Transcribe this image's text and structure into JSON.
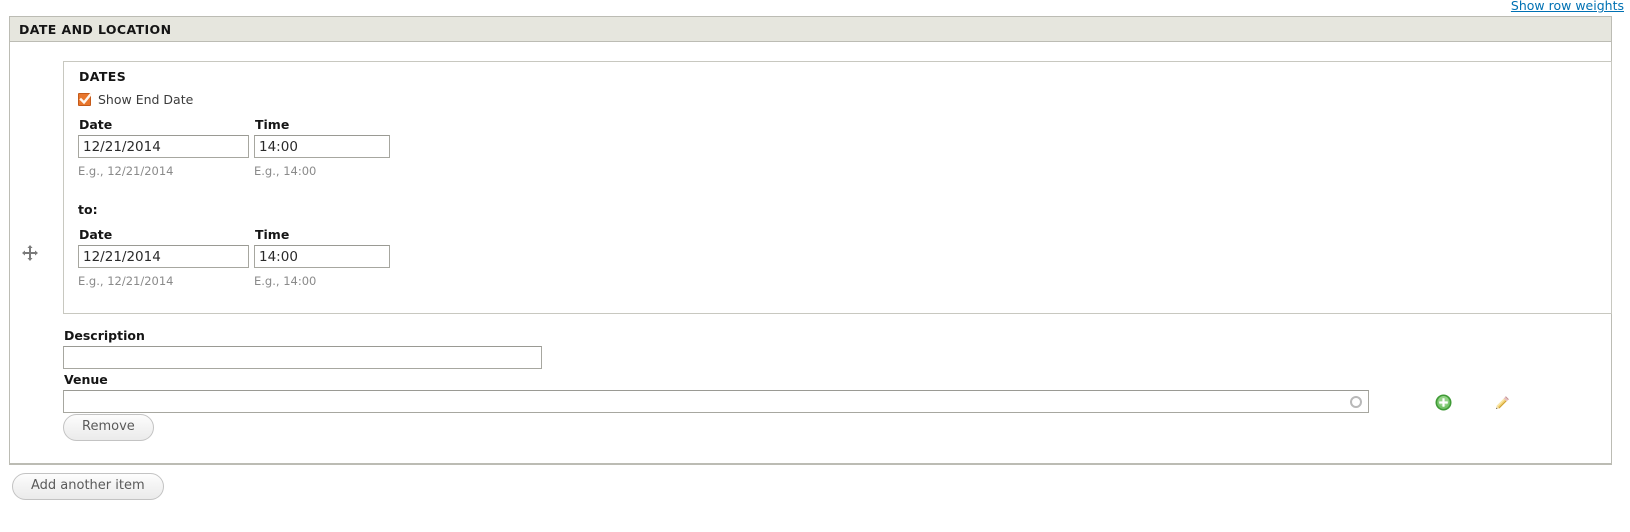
{
  "top": {
    "row_weights_link": "Show row weights"
  },
  "section": {
    "legend": "DATE AND LOCATION",
    "drag_handle_icon": "move-cross-icon"
  },
  "dates": {
    "legend": "DATES",
    "show_end_date": {
      "label": "Show End Date",
      "checked": true,
      "icon": "checkbox-checked-icon"
    },
    "start": {
      "date": {
        "label": "Date",
        "value": "12/21/2014",
        "hint": "E.g., 12/21/2014",
        "placeholder": ""
      },
      "time": {
        "label": "Time",
        "value": "14:00",
        "hint": "E.g., 14:00",
        "placeholder": ""
      }
    },
    "to_label": "to:",
    "end": {
      "date": {
        "label": "Date",
        "value": "12/21/2014",
        "hint": "E.g., 12/21/2014",
        "placeholder": ""
      },
      "time": {
        "label": "Time",
        "value": "14:00",
        "hint": "E.g., 14:00",
        "placeholder": ""
      }
    }
  },
  "description": {
    "label": "Description",
    "value": "",
    "placeholder": ""
  },
  "venue": {
    "label": "Venue",
    "value": "",
    "placeholder": "",
    "throbber_icon": "autocomplete-throbber-icon"
  },
  "side_icons": {
    "add": "add-green-plus-icon",
    "edit": "edit-pencil-icon"
  },
  "buttons": {
    "remove": "Remove",
    "add_another_item": "Add another item"
  },
  "colors": {
    "link": "#0071b3",
    "checkbox_accent": "#e8762c",
    "legend_bar": "#e6e6de",
    "add_icon_green": "#5aa84f",
    "edit_icon_gold": "#e0b040"
  }
}
